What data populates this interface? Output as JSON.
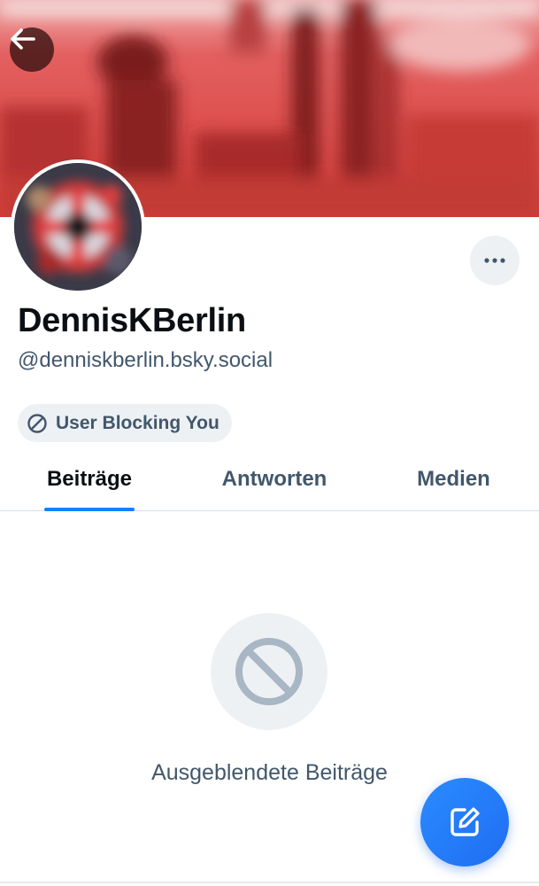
{
  "header": {
    "back_icon": "arrow-left-icon",
    "banner_color": "#d94a4a"
  },
  "profile": {
    "display_name": "DennisKBerlin",
    "handle": "@denniskberlin.bsky.social",
    "more_icon": "ellipsis-horizontal-icon",
    "block_badge": {
      "icon": "block-icon",
      "label": "User Blocking You"
    }
  },
  "tabs": [
    {
      "label": "Beiträge",
      "active": true
    },
    {
      "label": "Antworten",
      "active": false
    },
    {
      "label": "Medien",
      "active": false
    }
  ],
  "empty_state": {
    "icon": "block-icon",
    "message": "Ausgeblendete Beiträge"
  },
  "fab": {
    "icon": "compose-icon",
    "color": "#1f7af8"
  },
  "colors": {
    "accent": "#1083fe",
    "text_primary": "#0b0f14",
    "text_secondary": "#42576c",
    "pill_bg": "#eef1f4"
  }
}
